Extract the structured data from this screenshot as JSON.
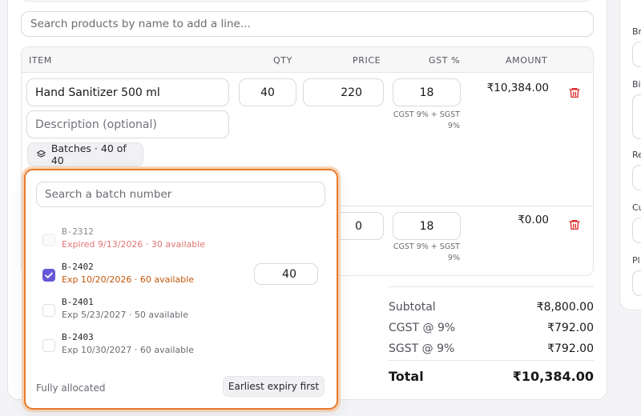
{
  "search": {
    "placeholder": "Search products by name to add a line..."
  },
  "table": {
    "headers": {
      "item": "ITEM",
      "qty": "QTY",
      "price": "PRICE",
      "gst": "GST %",
      "amount": "AMOUNT"
    },
    "lines": [
      {
        "item": "Hand Sanitizer 500 ml",
        "description_placeholder": "Description (optional)",
        "qty": "40",
        "price": "220",
        "gst": "18",
        "gst_note_1": "CGST 9% + SGST",
        "gst_note_2": "9%",
        "amount": "₹10,384.00",
        "batches_label": "Batches · 40 of 40"
      },
      {
        "price": "0",
        "gst": "18",
        "gst_note_1": "CGST 9% + SGST",
        "gst_note_2": "9%",
        "amount": "₹0.00"
      }
    ]
  },
  "totals": {
    "subtotal_label": "Subtotal",
    "subtotal": "₹8,800.00",
    "cgst_label": "CGST @ 9%",
    "cgst": "₹792.00",
    "sgst_label": "SGST @ 9%",
    "sgst": "₹792.00",
    "total_label": "Total",
    "total": "₹10,384.00"
  },
  "side_panel": {
    "labels": [
      "Br",
      "Bi",
      "Re",
      "Cu",
      "Pl"
    ]
  },
  "batch_popover": {
    "search_placeholder": "Search a batch number",
    "batches": [
      {
        "code": "B-2312",
        "meta": "Expired 9/13/2026 · 30 available",
        "state": "expired",
        "checked": false
      },
      {
        "code": "B-2402",
        "meta": "Exp 10/20/2026 · 60 available",
        "state": "selected",
        "checked": true,
        "allocated_qty": "40"
      },
      {
        "code": "B-2401",
        "meta": "Exp 5/23/2027 · 50 available",
        "state": "available",
        "checked": false
      },
      {
        "code": "B-2403",
        "meta": "Exp 10/30/2027 · 60 available",
        "state": "available",
        "checked": false
      }
    ],
    "status": "Fully allocated",
    "auto_allocate_label": "Earliest expiry first"
  },
  "colors": {
    "accent": "#6458d6",
    "popover_border": "#ea7b2c",
    "expired": "#e07575",
    "selected_meta": "#c2570c",
    "trash": "#dc2626"
  },
  "icons": {
    "trash": "trash-icon",
    "layers": "layers-icon",
    "check": "check-icon"
  }
}
